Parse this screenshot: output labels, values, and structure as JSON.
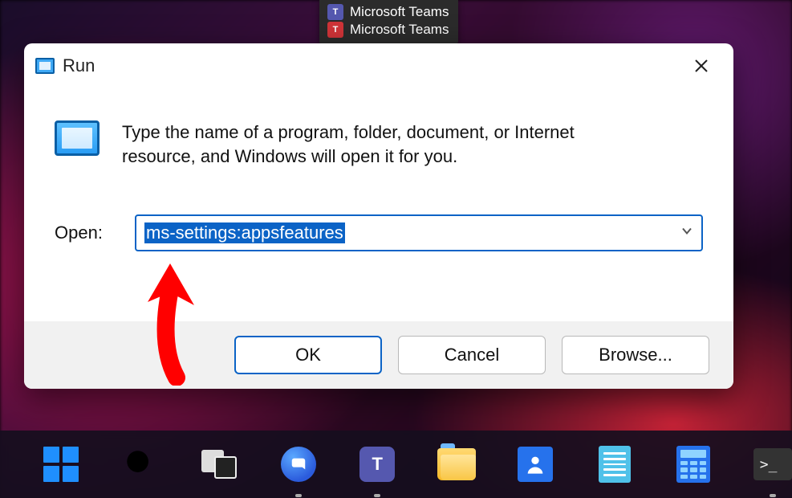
{
  "tooltip": {
    "items": [
      {
        "label": "Microsoft Teams",
        "color": "purple"
      },
      {
        "label": "Microsoft Teams",
        "color": "red"
      }
    ]
  },
  "dialog": {
    "title": "Run",
    "description": "Type the name of a program, folder, document, or Internet resource, and Windows will open it for you.",
    "open_label": "Open:",
    "input_value": "ms-settings:appsfeatures",
    "buttons": {
      "ok": "OK",
      "cancel": "Cancel",
      "browse": "Browse..."
    }
  },
  "taskbar": {
    "items": [
      "start",
      "search",
      "task-view",
      "chat",
      "teams",
      "file-explorer",
      "people",
      "notepad",
      "calculator",
      "terminal"
    ]
  }
}
